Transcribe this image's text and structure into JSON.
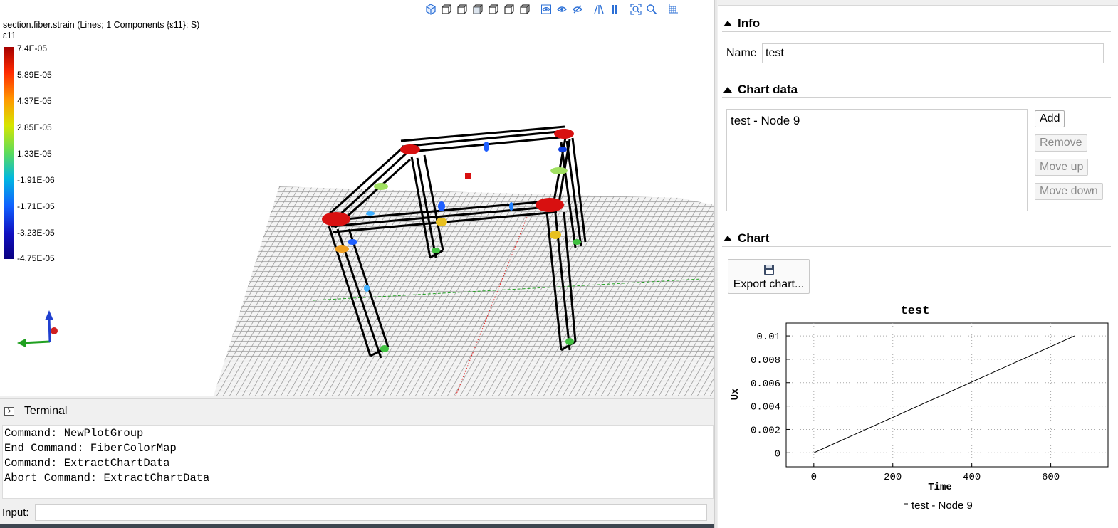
{
  "viewport": {
    "result_title": "section.fiber.strain (Lines; 1 Components {ε11}; S)",
    "legend_label": "ε11",
    "colorbar_ticks": [
      "7.4E-05",
      "5.89E-05",
      "4.37E-05",
      "2.85E-05",
      "1.33E-05",
      "-1.91E-06",
      "-1.71E-05",
      "-3.23E-05",
      "-4.75E-05"
    ],
    "toolbar_icons": [
      "view-iso-icon",
      "view-front-icon",
      "view-back-icon",
      "view-left-icon",
      "view-right-icon",
      "view-top-icon",
      "view-bottom-icon",
      "show-hide-icon",
      "show-all-icon",
      "hide-icon",
      "perspective-icon",
      "parallel-icon",
      "zoom-fit-icon",
      "zoom-icon",
      "grid-icon"
    ]
  },
  "terminal": {
    "title": "Terminal",
    "lines": [
      "Command: NewPlotGroup",
      "End Command: FiberColorMap",
      "Command: ExtractChartData",
      "Abort Command: ExtractChartData"
    ],
    "input_label": "Input:",
    "input_value": ""
  },
  "panel": {
    "info": {
      "title": "Info",
      "name_label": "Name",
      "name_value": "test"
    },
    "chart_data_section": {
      "title": "Chart data",
      "items": [
        "test - Node 9"
      ],
      "add_label": "Add",
      "remove_label": "Remove",
      "move_up_label": "Move up",
      "move_down_label": "Move down"
    },
    "chart_section": {
      "title": "Chart",
      "export_label": "Export chart..."
    }
  },
  "chart_data": {
    "type": "line",
    "title": "test",
    "xlabel": "Time",
    "ylabel": "Ux",
    "xlim": [
      -70,
      745
    ],
    "ylim": [
      -0.0012,
      0.0111
    ],
    "x_ticks": [
      "0",
      "200",
      "400",
      "600"
    ],
    "y_ticks": [
      "0",
      "0.002",
      "0.004",
      "0.006",
      "0.008",
      "0.01"
    ],
    "grid": true,
    "legend": "bottom",
    "series": [
      {
        "name": "test - Node 9",
        "x": [
          0,
          660
        ],
        "y": [
          0,
          0.01
        ],
        "color": "#000000"
      }
    ]
  }
}
